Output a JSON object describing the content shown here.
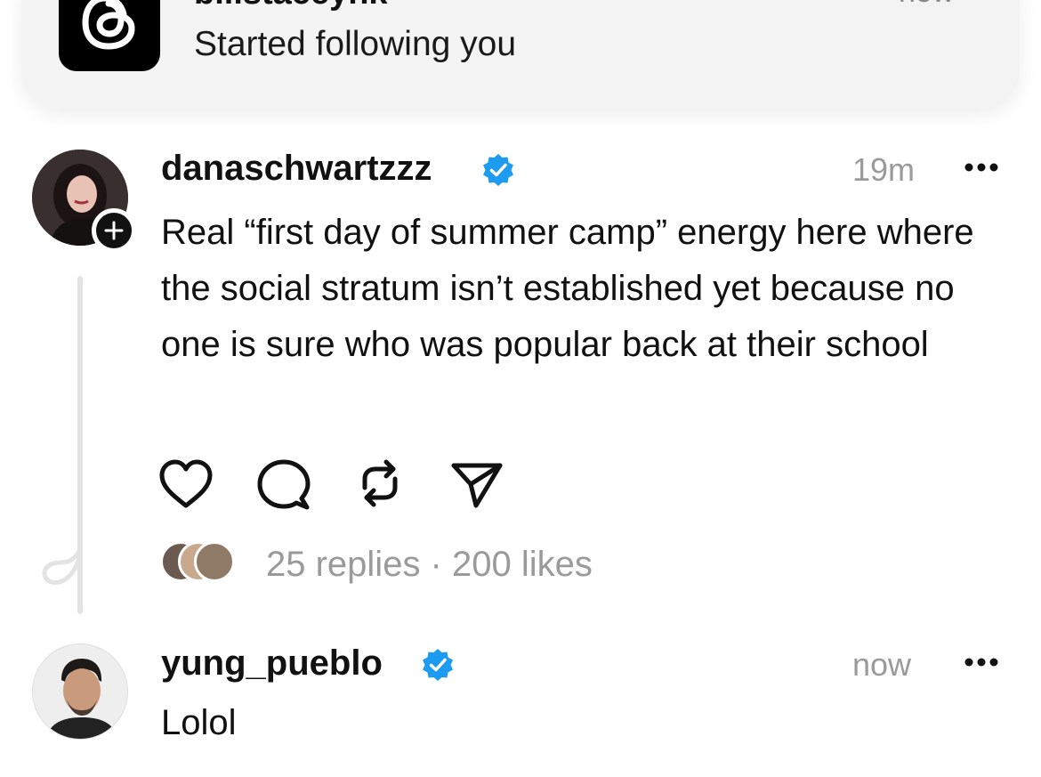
{
  "notification": {
    "app_icon": "threads-icon",
    "username": "billstaceyhk",
    "time": "now",
    "message": "Started following you"
  },
  "posts": [
    {
      "username": "danaschwartzzz",
      "verified": true,
      "time": "19m",
      "text": "Real “first day of summer camp” energy here where the social stratum isn’t established yet because no one is sure who was popular back at their school",
      "stats": "25 replies · 200 likes"
    },
    {
      "username": "yung_pueblo",
      "verified": true,
      "time": "now",
      "text": "Lolol"
    }
  ],
  "colors": {
    "verified_badge": "#1d9bf0",
    "muted_text": "#9a9a9a",
    "banner_bg": "#f3f3f3"
  }
}
